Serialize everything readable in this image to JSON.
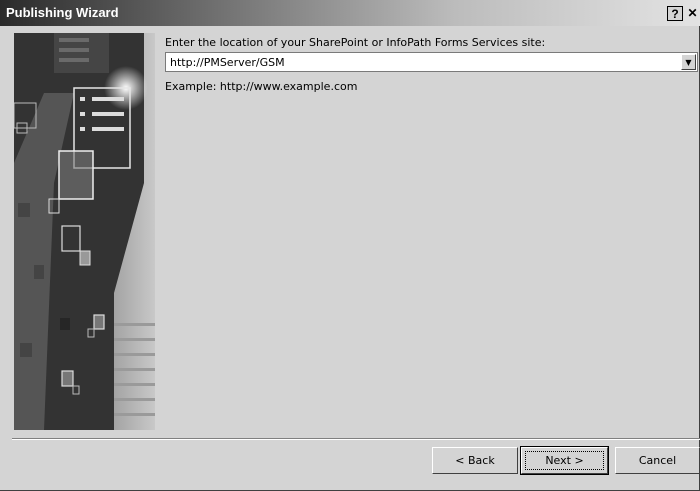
{
  "window": {
    "title": "Publishing Wizard",
    "help_label": "?",
    "close_label": "✕"
  },
  "location": {
    "prompt": "Enter the location of your SharePoint or InfoPath Forms Services site:",
    "value": "http://PMServer/GSM",
    "example": "Example: http://www.example.com",
    "dropdown_icon": "chevron-down-icon"
  },
  "buttons": {
    "back": "< Back",
    "next": "Next >",
    "cancel": "Cancel"
  },
  "colors": {
    "title_dark": "#2a2a2a",
    "dialog_face": "#d4d4d4"
  }
}
